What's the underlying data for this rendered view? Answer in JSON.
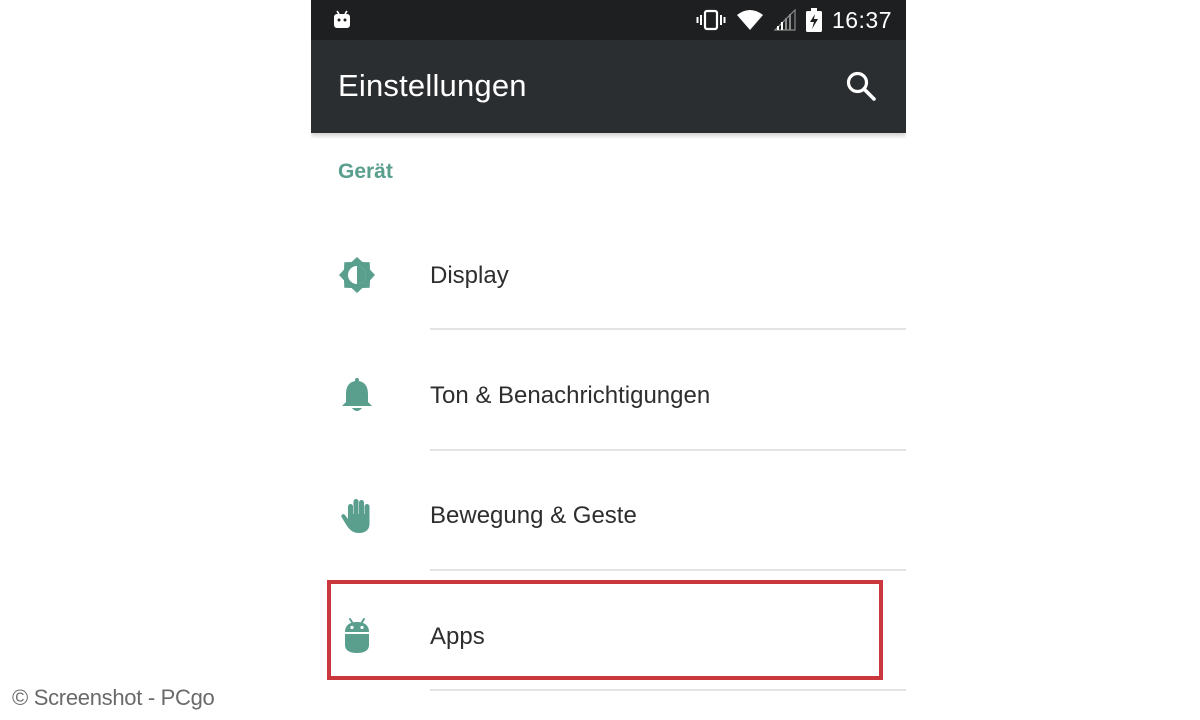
{
  "status_bar": {
    "left_icon": "android-notification-icon",
    "icons": [
      "vibrate-icon",
      "wifi-icon",
      "cell-signal-icon",
      "battery-charging-icon"
    ],
    "time": "16:37"
  },
  "app_bar": {
    "title": "Einstellungen",
    "search_icon": "search-icon"
  },
  "section": {
    "header": "Gerät"
  },
  "items": [
    {
      "label": "Display",
      "icon": "brightness-icon"
    },
    {
      "label": "Ton & Benachrichtigungen",
      "icon": "bell-icon"
    },
    {
      "label": "Bewegung & Geste",
      "icon": "hand-icon"
    },
    {
      "label": "Apps",
      "icon": "android-icon",
      "highlighted": true
    }
  ],
  "watermark": "© Screenshot - PCgo",
  "colors": {
    "status_bar": "#1d1f21",
    "app_bar": "#2b2e31",
    "accent": "#5a9e8e",
    "highlight": "#c9363b"
  }
}
